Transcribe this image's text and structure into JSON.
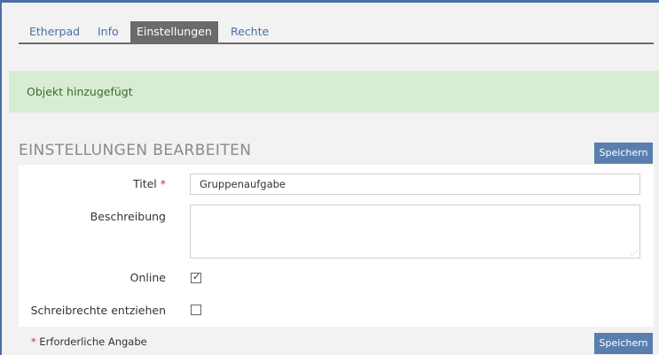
{
  "tabs": [
    {
      "label": "Etherpad",
      "active": false
    },
    {
      "label": "Info",
      "active": false
    },
    {
      "label": "Einstellungen",
      "active": true
    },
    {
      "label": "Rechte",
      "active": false
    }
  ],
  "alert": {
    "message": "Objekt hinzugefügt",
    "color": "#d8ecd3"
  },
  "section": {
    "title": "EINSTELLUNGEN BEARBEITEN"
  },
  "buttons": {
    "save_top": "Speichern",
    "save_bottom": "Speichern"
  },
  "form": {
    "title_label": "Titel",
    "required_marker": "*",
    "title_value": "Gruppenaufgabe",
    "description_label": "Beschreibung",
    "description_value": "",
    "online_label": "Online",
    "online_checked": true,
    "revoke_label": "Schreibrechte entziehen",
    "revoke_checked": false
  },
  "footer": {
    "required_marker": "*",
    "required_note": "Erforderliche Angabe"
  },
  "colors": {
    "accent": "#4a6fa5",
    "button": "#5a7fae",
    "required": "#c0392b"
  }
}
